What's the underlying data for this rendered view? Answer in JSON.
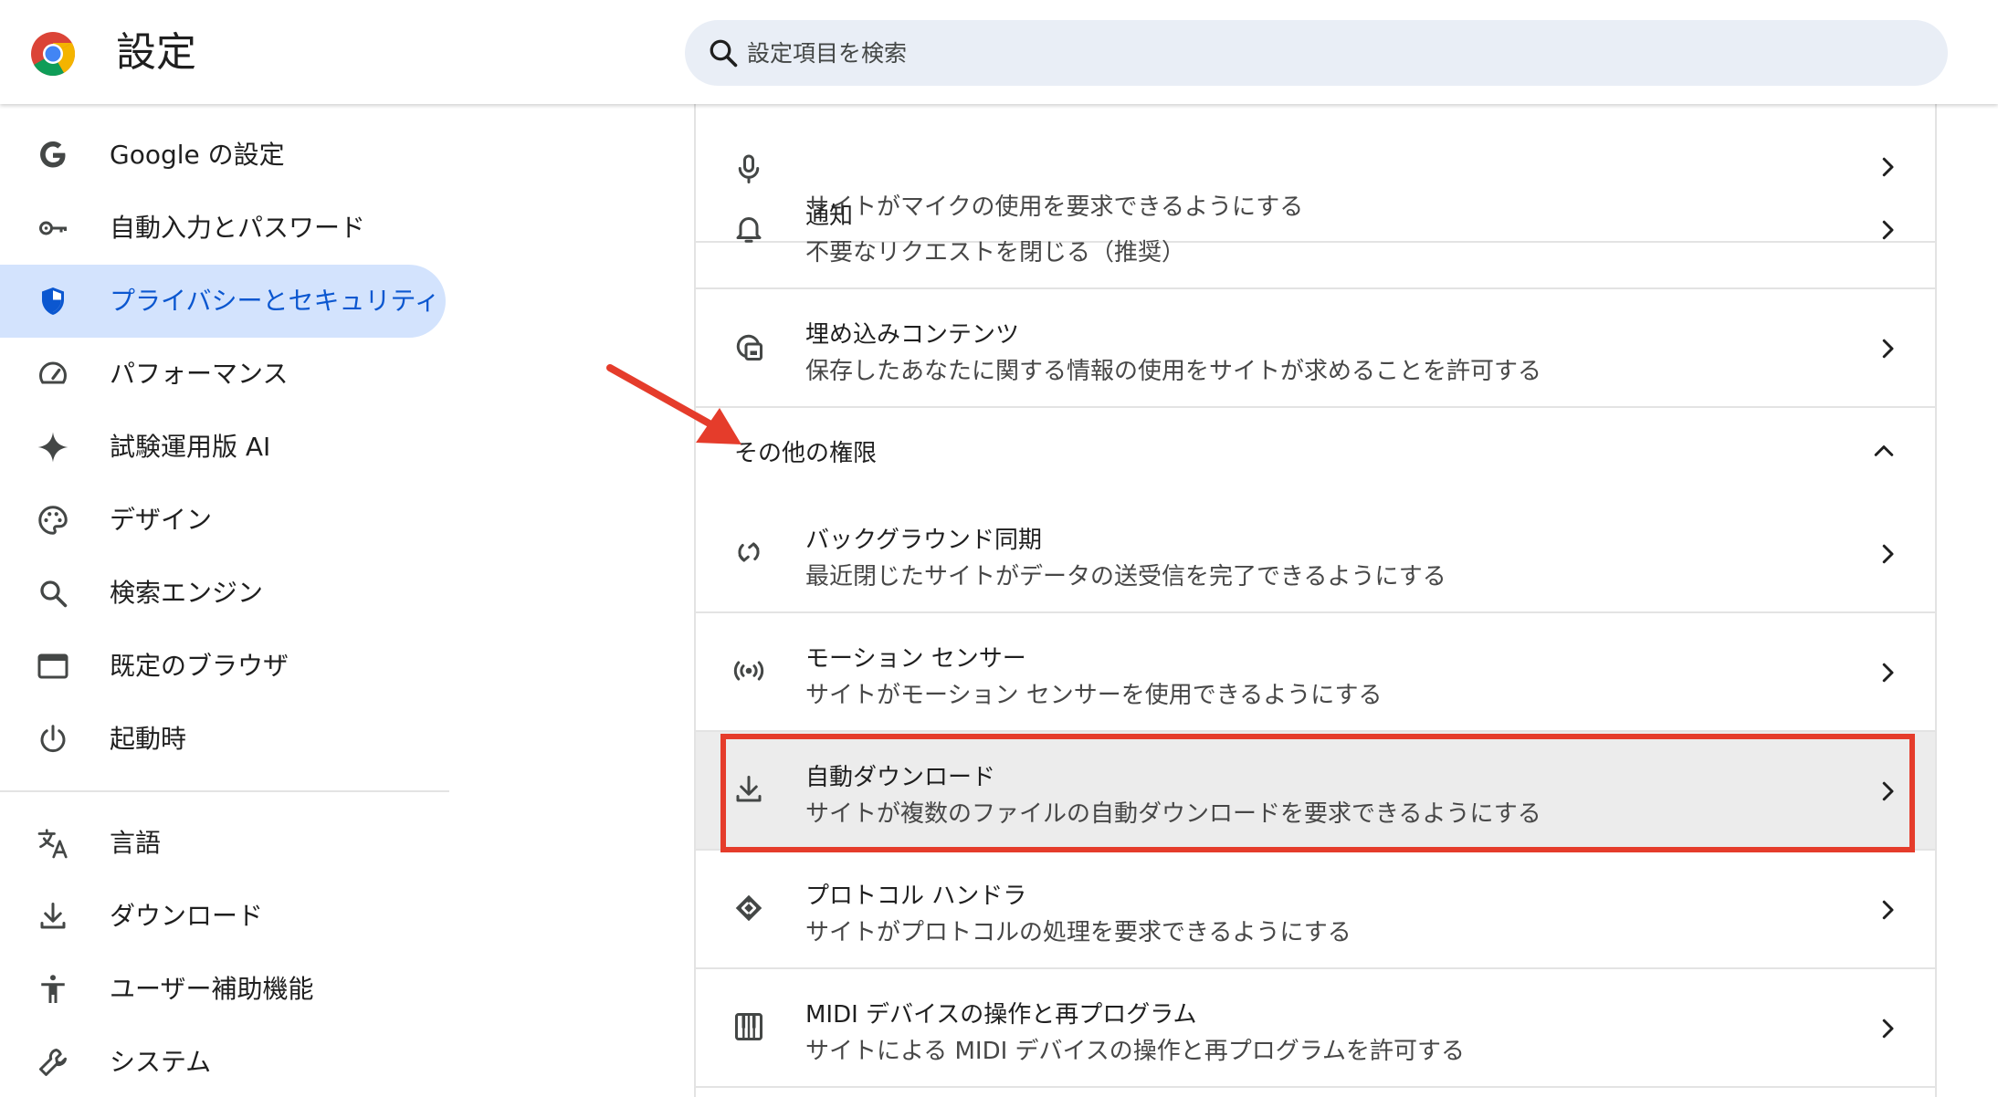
{
  "header": {
    "title": "設定",
    "search_placeholder": "設定項目を検索",
    "logo": "chrome-logo"
  },
  "sidebar": {
    "items": [
      {
        "label": "Google の設定",
        "icon": "google-g-icon"
      },
      {
        "label": "自動入力とパスワード",
        "icon": "key-icon"
      },
      {
        "label": "プライバシーとセキュリティ",
        "icon": "shield-icon",
        "active": true
      },
      {
        "label": "パフォーマンス",
        "icon": "speedometer-icon"
      },
      {
        "label": "試験運用版 AI",
        "icon": "sparkle-icon"
      },
      {
        "label": "デザイン",
        "icon": "palette-icon"
      },
      {
        "label": "検索エンジン",
        "icon": "search-icon"
      },
      {
        "label": "既定のブラウザ",
        "icon": "browser-window-icon"
      },
      {
        "label": "起動時",
        "icon": "power-icon"
      },
      {
        "label": "言語",
        "icon": "translate-icon"
      },
      {
        "label": "ダウンロード",
        "icon": "download-icon"
      },
      {
        "label": "ユーザー補助機能",
        "icon": "accessibility-icon"
      },
      {
        "label": "システム",
        "icon": "wrench-icon"
      }
    ]
  },
  "main": {
    "rows_top": [
      {
        "title": "",
        "subtitle": "サイトがマイクの使用を要求できるようにする",
        "icon": "microphone-icon"
      },
      {
        "title": "通知",
        "subtitle": "不要なリクエストを閉じる（推奨）",
        "icon": "bell-icon"
      },
      {
        "title": "埋め込みコンテンツ",
        "subtitle": "保存したあなたに関する情報の使用をサイトが求めることを許可する",
        "icon": "embedded-content-icon"
      }
    ],
    "section_title": "その他の権限",
    "rows_more": [
      {
        "title": "バックグラウンド同期",
        "subtitle": "最近閉じたサイトがデータの送受信を完了できるようにする",
        "icon": "sync-icon"
      },
      {
        "title": "モーション センサー",
        "subtitle": "サイトがモーション センサーを使用できるようにする",
        "icon": "sensor-icon"
      },
      {
        "title": "自動ダウンロード",
        "subtitle": "サイトが複数のファイルの自動ダウンロードを要求できるようにする",
        "icon": "download-icon",
        "highlighted": true
      },
      {
        "title": "プロトコル ハンドラ",
        "subtitle": "サイトがプロトコルの処理を要求できるようにする",
        "icon": "protocol-handler-icon"
      },
      {
        "title": "MIDI デバイスの操作と再プログラム",
        "subtitle": "サイトによる MIDI デバイスの操作と再プログラムを許可する",
        "icon": "piano-icon"
      }
    ]
  },
  "colors": {
    "accent": "#0b57d0",
    "active_bg": "#d3e3fd",
    "search_bg": "#e9eef6",
    "annotation": "#e53c2b",
    "highlight_row": "#ececec"
  }
}
